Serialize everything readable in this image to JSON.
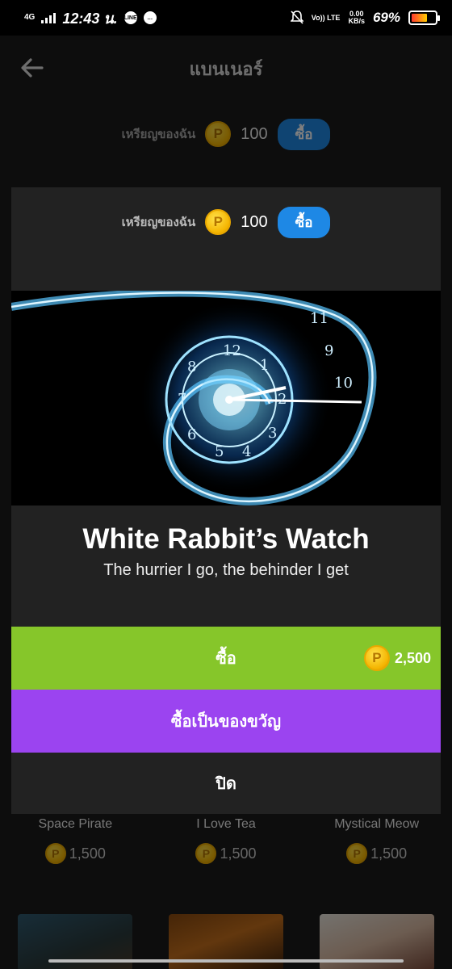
{
  "status_bar": {
    "network": "4G",
    "time": "12:43 น.",
    "line_icon": "LINE",
    "volte": "Vo)) LTE",
    "speed": "0.00",
    "speed_unit": "KB/s",
    "battery_pct": "69%",
    "battery_level": 0.69
  },
  "page": {
    "title": "แบนเนอร์",
    "coins_label": "เหรียญของฉัน",
    "coins_amount": "100",
    "buy_label": "ซื้อ",
    "items": [
      {
        "name": "Space Pirate",
        "price": "1,500"
      },
      {
        "name": "I Love Tea",
        "price": "1,500"
      },
      {
        "name": "Mystical Meow",
        "price": "1,500"
      }
    ]
  },
  "modal": {
    "coins_label": "เหรียญของฉัน",
    "coins_amount": "100",
    "buy_pill_label": "ซื้อ",
    "item_title": "White Rabbit’s Watch",
    "item_description": "The hurrier I go, the behinder I get",
    "buy_label": "ซื้อ",
    "buy_price": "2,500",
    "gift_label": "ซื้อเป็นของขวัญ",
    "close_label": "ปิด"
  },
  "coin_symbol": "P",
  "colors": {
    "accent_blue": "#1e88e5",
    "buy_green": "#86c62a",
    "gift_purple": "#9b44f0",
    "coin_gold": "#f4b400",
    "modal_bg": "#222222"
  }
}
